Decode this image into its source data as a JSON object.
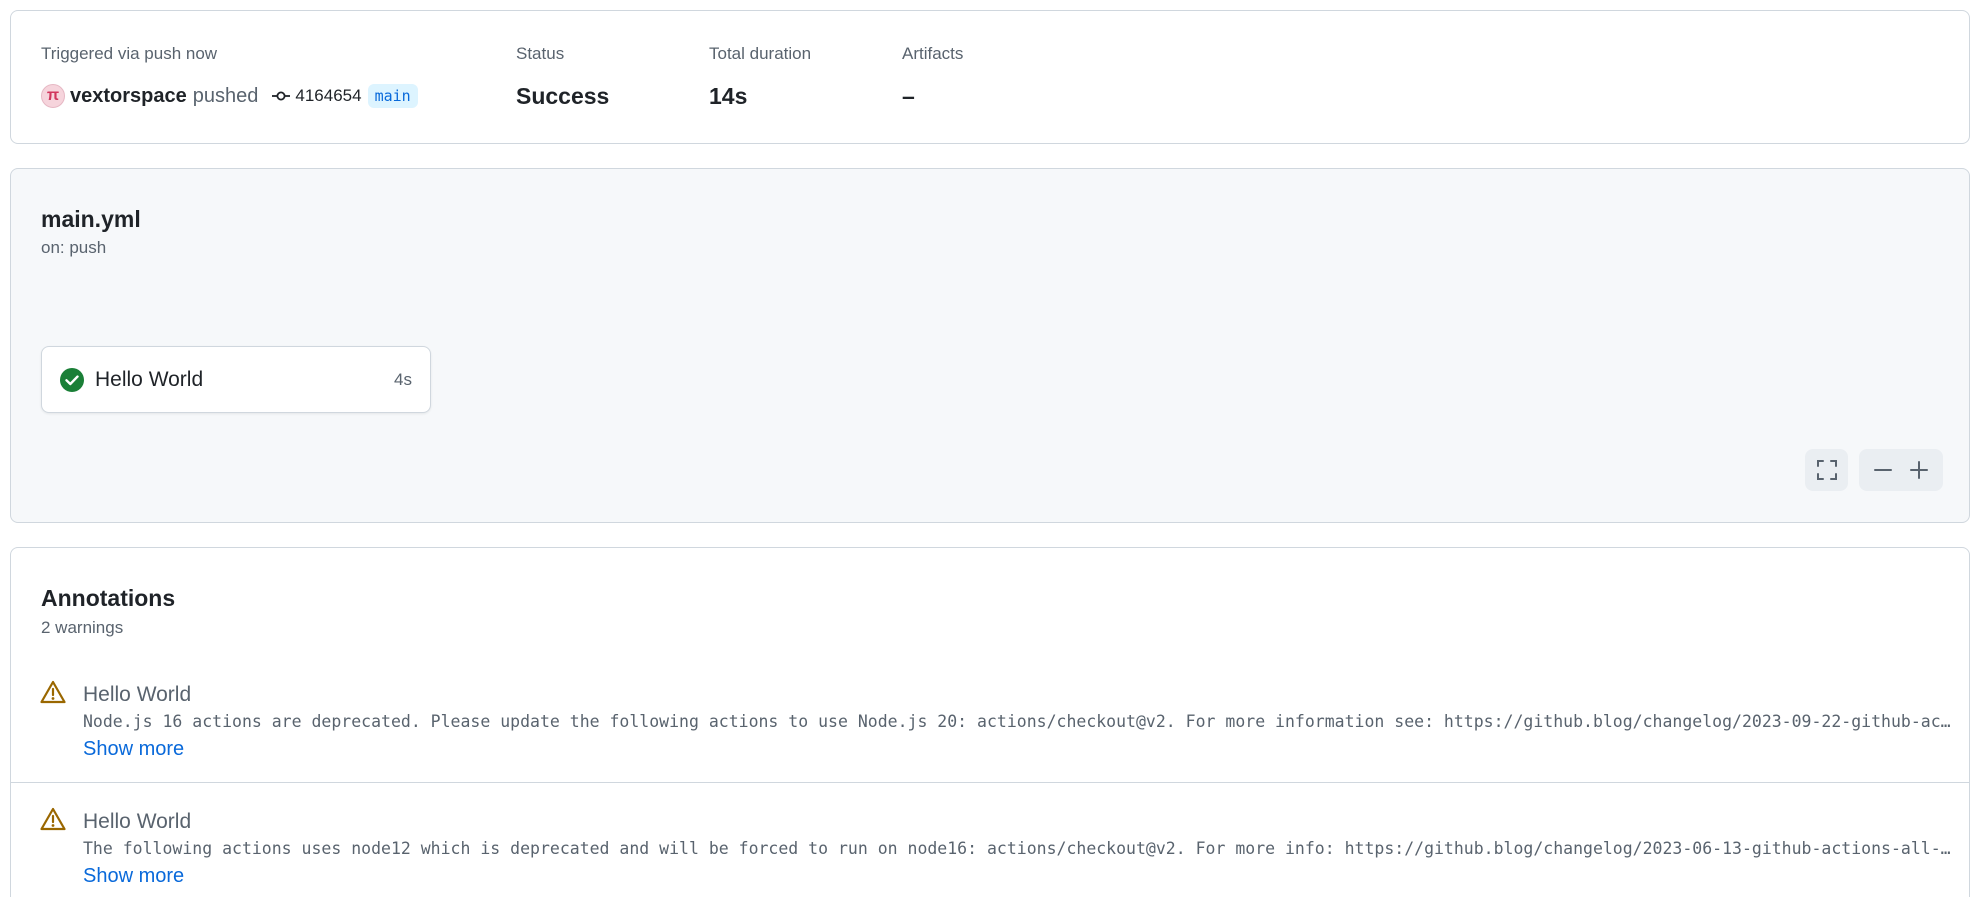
{
  "summary": {
    "trigger_text": "Triggered via push now",
    "avatar_glyph": "π",
    "username": "vextorspace",
    "action": "pushed",
    "commit_sha": "4164654",
    "branch": "main",
    "status_label": "Status",
    "status_value": "Success",
    "duration_label": "Total duration",
    "duration_value": "14s",
    "artifacts_label": "Artifacts",
    "artifacts_value": "–"
  },
  "workflow": {
    "file_name": "main.yml",
    "trigger": "on: push",
    "job": {
      "name": "Hello World",
      "duration": "4s",
      "status": "success",
      "status_icon": "check-circle-icon"
    },
    "controls": [
      "fullscreen-icon",
      "zoom-out-icon",
      "zoom-in-icon"
    ]
  },
  "annotations": {
    "title": "Annotations",
    "count": "2 warnings",
    "items": [
      {
        "icon": "warning-icon",
        "job": "Hello World",
        "message": "Node.js 16 actions are deprecated. Please update the following actions to use Node.js 20: actions/checkout@v2. For more information see: https://github.blog/changelog/2023-09-22-github-ac…",
        "show_more": "Show more"
      },
      {
        "icon": "warning-icon",
        "job": "Hello World",
        "message": "The following actions uses node12 which is deprecated and will be forced to run on node16: actions/checkout@v2. For more info: https://github.blog/changelog/2023-06-13-github-actions-all-…",
        "show_more": "Show more"
      }
    ]
  },
  "colors": {
    "success": "#1a7f37",
    "warning": "#9a6700",
    "link": "#0969da",
    "muted": "#59636e",
    "border": "#d0d7de"
  }
}
